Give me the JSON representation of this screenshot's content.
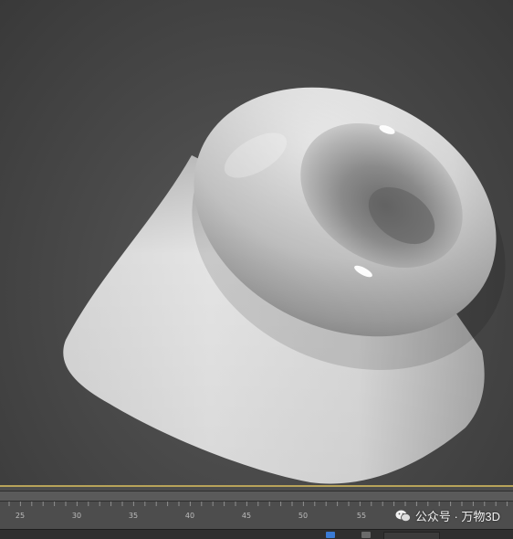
{
  "timeline": {
    "ticks": [
      "25",
      "30",
      "35",
      "40",
      "45",
      "50",
      "55"
    ]
  },
  "watermark": {
    "text": "公众号 · 万物3D"
  },
  "colors": {
    "viewport_bg": "#4a4a4a",
    "viewport_border": "#b8a35a",
    "timeline_bg": "#4d4d4d",
    "status_accent": "#3a7bd5"
  },
  "icons": {
    "watermark": "wechat-icon",
    "status_key": "key-icon",
    "status_filter": "filter-icon"
  }
}
